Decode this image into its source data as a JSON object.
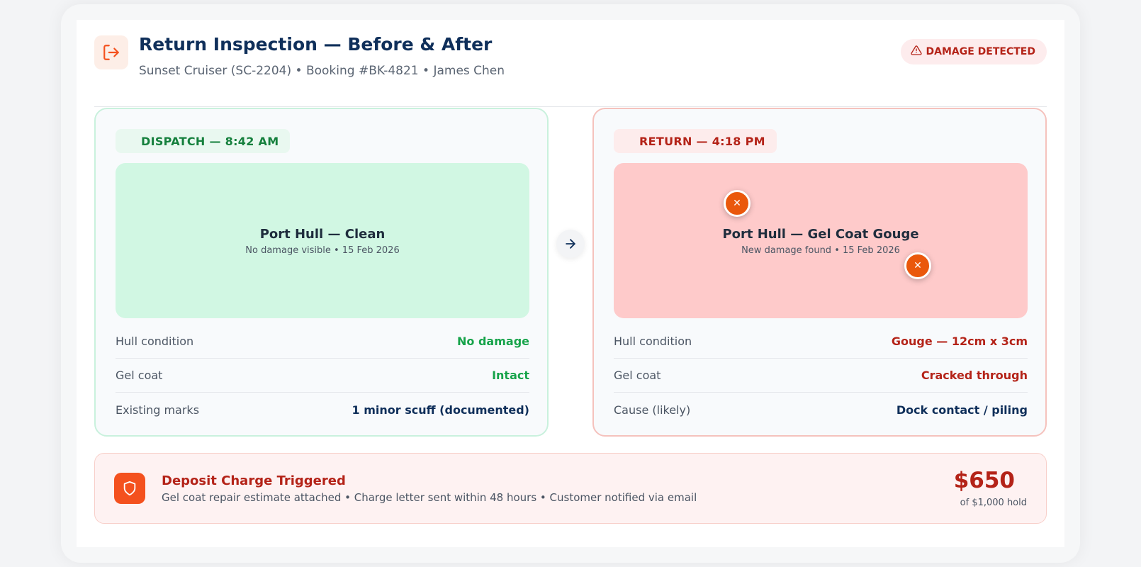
{
  "header": {
    "title": "Return Inspection — Before & After",
    "subtitle": "Sunset Cruiser (SC-2204) • Booking #BK-4821 • James Chen",
    "icon": "exit-icon",
    "badge_label": "DAMAGE DETECTED",
    "badge_icon": "warning-icon"
  },
  "dispatch": {
    "tag": "DISPATCH — 8:42 AM",
    "photo_title": "Port Hull — Clean",
    "photo_sub": "No damage visible • 15 Feb 2026",
    "rows": [
      {
        "label": "Hull condition",
        "value": "No damage"
      },
      {
        "label": "Gel coat",
        "value": "Intact"
      },
      {
        "label": "Existing marks",
        "value": "1 minor scuff (documented)"
      }
    ]
  },
  "return": {
    "tag": "RETURN — 4:18 PM",
    "photo_title": "Port Hull — Gel Coat Gouge",
    "photo_sub": "New damage found • 15 Feb 2026",
    "marker_glyph": "✕",
    "rows": [
      {
        "label": "Hull condition",
        "value": "Gouge — 12cm x 3cm"
      },
      {
        "label": "Gel coat",
        "value": "Cracked through"
      },
      {
        "label": "Cause (likely)",
        "value": "Dock contact / piling"
      }
    ]
  },
  "deposit": {
    "title": "Deposit Charge Triggered",
    "subtitle": "Gel coat repair estimate attached • Charge letter sent within 48 hours • Customer notified via email",
    "amount": "$650",
    "hold": "of $1,000 hold",
    "icon": "shield-icon"
  },
  "colors": {
    "navy": "#0f2f5a",
    "green": "#16a34a",
    "red": "#b42318",
    "orange": "#ea580c"
  }
}
